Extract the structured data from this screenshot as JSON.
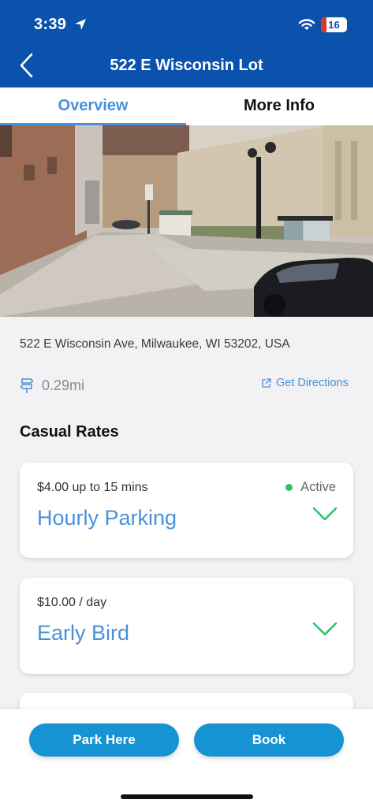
{
  "status_bar": {
    "time": "3:39",
    "battery": "16"
  },
  "header": {
    "title": "522 E Wisconsin Lot"
  },
  "tabs": [
    {
      "label": "Overview"
    },
    {
      "label": "More Info"
    }
  ],
  "location": {
    "address": "522 E Wisconsin Ave, Milwaukee, WI 53202, USA",
    "distance": "0.29mi",
    "directions_label": "Get Directions"
  },
  "rates": {
    "section_title": "Casual Rates",
    "items": [
      {
        "price": "$4.00 up to 15 mins",
        "name": "Hourly Parking",
        "status": "Active"
      },
      {
        "price": "$10.00 / day",
        "name": "Early Bird"
      }
    ]
  },
  "actions": {
    "park_label": "Park Here",
    "book_label": "Book"
  },
  "colors": {
    "brand": "#0a52ab",
    "accent": "#4a90d9",
    "button": "#1593d3",
    "active": "#2ec267"
  }
}
